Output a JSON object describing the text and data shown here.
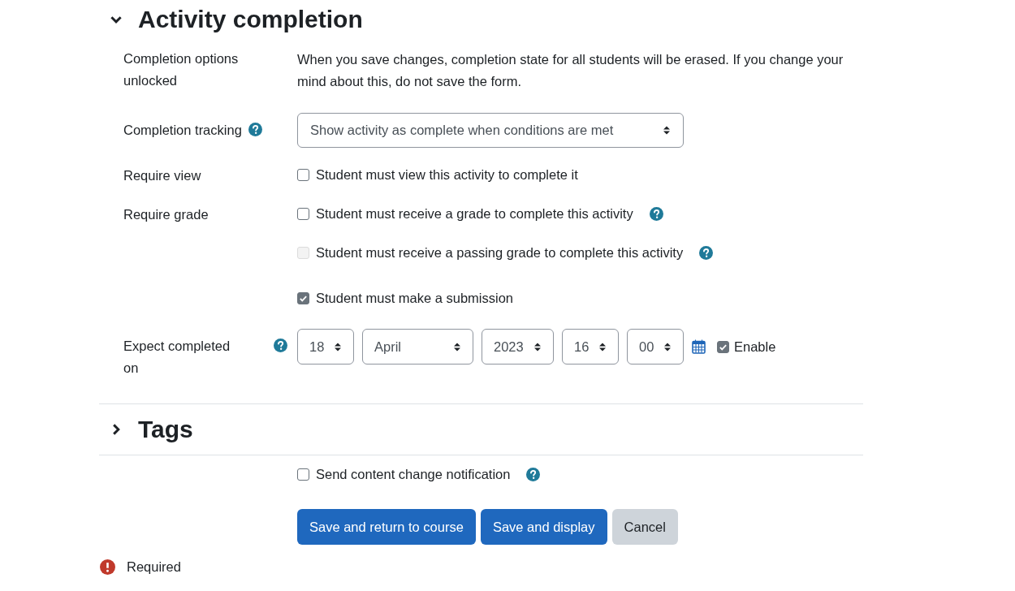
{
  "activity_completion": {
    "title": "Activity completion",
    "expanded": true,
    "rows": [
      {
        "kind": "text",
        "label": "Completion options unlocked",
        "help": false,
        "text": "When you save changes, completion state for all students will be erased. If you change your mind about this, do not save the form."
      },
      {
        "kind": "select",
        "label": "Completion tracking",
        "help": true,
        "value": "Show activity as complete when conditions are met"
      },
      {
        "kind": "checkboxes",
        "label": "Require view",
        "help": false,
        "options": [
          {
            "label": "Student must view this activity to complete it",
            "checked": false,
            "disabled": false,
            "help": false
          }
        ]
      },
      {
        "kind": "checkboxes",
        "label": "Require grade",
        "help": false,
        "options": [
          {
            "label": "Student must receive a grade to complete this activity",
            "checked": false,
            "disabled": false,
            "help": true
          },
          {
            "label": "Student must receive a passing grade to complete this activity",
            "checked": false,
            "disabled": true,
            "help": true
          },
          {
            "label": "Student must make a submission",
            "checked": true,
            "disabled": false,
            "help": false
          }
        ]
      },
      {
        "kind": "date",
        "label": "Expect completed on",
        "help": true,
        "fields": [
          {
            "value": "18"
          },
          {
            "value": "April"
          },
          {
            "value": "2023"
          },
          {
            "value": "16"
          },
          {
            "value": "00"
          }
        ],
        "enable": {
          "label": "Enable",
          "checked": true
        }
      }
    ]
  },
  "tags": {
    "title": "Tags",
    "expanded": false
  },
  "notification": {
    "label": "Send content change notification",
    "checked": false,
    "help": true
  },
  "buttons": [
    {
      "label": "Save and return to course",
      "kind": "primary"
    },
    {
      "label": "Save and display",
      "kind": "primary"
    },
    {
      "label": "Cancel",
      "kind": "secondary"
    }
  ],
  "required_note": "Required"
}
